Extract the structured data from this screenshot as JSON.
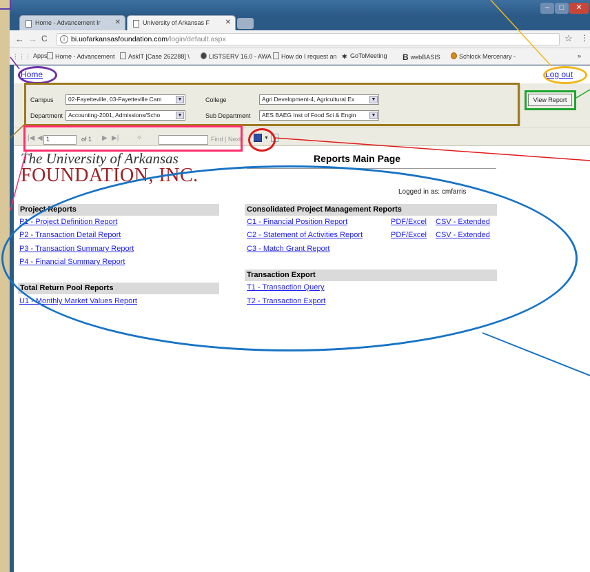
{
  "browser": {
    "tabs": [
      {
        "title": "Home - Advancement Ir"
      },
      {
        "title": "University of Arkansas F"
      }
    ],
    "url_host": "bi.uofarkansasfoundation.com",
    "url_path": "/login/default.aspx",
    "bookmarks": [
      "Apps",
      "Home - Advancement",
      "AskIT [Case 262288] \\",
      "LISTSERV 16.0 - AWA",
      "How do I request an",
      "GoToMeeting",
      "webBASIS",
      "Schlock Mercenary -",
      "»"
    ]
  },
  "topbar": {
    "home": "Home",
    "logout": "Log out"
  },
  "params": {
    "campus_label": "Campus",
    "campus_value": "02-Fayetteville, 03-Fayetteville Cam",
    "college_label": "College",
    "college_value": "Agri Development-4, Agricultural Ex",
    "department_label": "Department",
    "department_value": "Accounting-2001, Admissions/Scho",
    "subdept_label": "Sub Department",
    "subdept_value": "AES BAEG Inst of Food Sci & Engin",
    "view_report": "View Report"
  },
  "toolbar": {
    "page_value": "1",
    "of_pages": "of 1",
    "find_next": "Find | Next"
  },
  "report": {
    "logo_line1": "The University of Arkansas",
    "logo_line2": "FOUNDATION, INC.",
    "title": "Reports Main Page",
    "logged_in": "Logged in as: cmfarris",
    "project_reports": {
      "heading": "Project Reports",
      "links": [
        "P1 - Project Definition Report",
        "P2 - Transaction Detail Report",
        "P3 - Transaction Summary Report",
        "P4 - Financial Summary Report"
      ]
    },
    "total_return": {
      "heading": "Total Return Pool Reports",
      "links": [
        "U1 - Monthly Market Values Report"
      ]
    },
    "consolidated": {
      "heading": "Consolidated Project Management Reports",
      "links": [
        "C1 - Financial Position Report",
        "C2 - Statement of Activities Report",
        "C3 - Match Grant Report"
      ],
      "pdf_excel": "PDF/Excel",
      "csv_extended": "CSV - Extended"
    },
    "transaction_export": {
      "heading": "Transaction Export",
      "links": [
        "T1 - Transaction Query",
        "T2 - Transaction Export"
      ]
    }
  },
  "colors": {
    "annotation_home": "#6f2fa8",
    "annotation_logout": "#f2b61a",
    "annotation_params": "#9c7a1c",
    "annotation_view_report": "#1ea531",
    "annotation_navigation": "#ff2d6a",
    "annotation_export": "#e01b1b",
    "annotation_reports": "#1773c4",
    "link": "#2222ee",
    "logo_red": "#9b2025"
  }
}
